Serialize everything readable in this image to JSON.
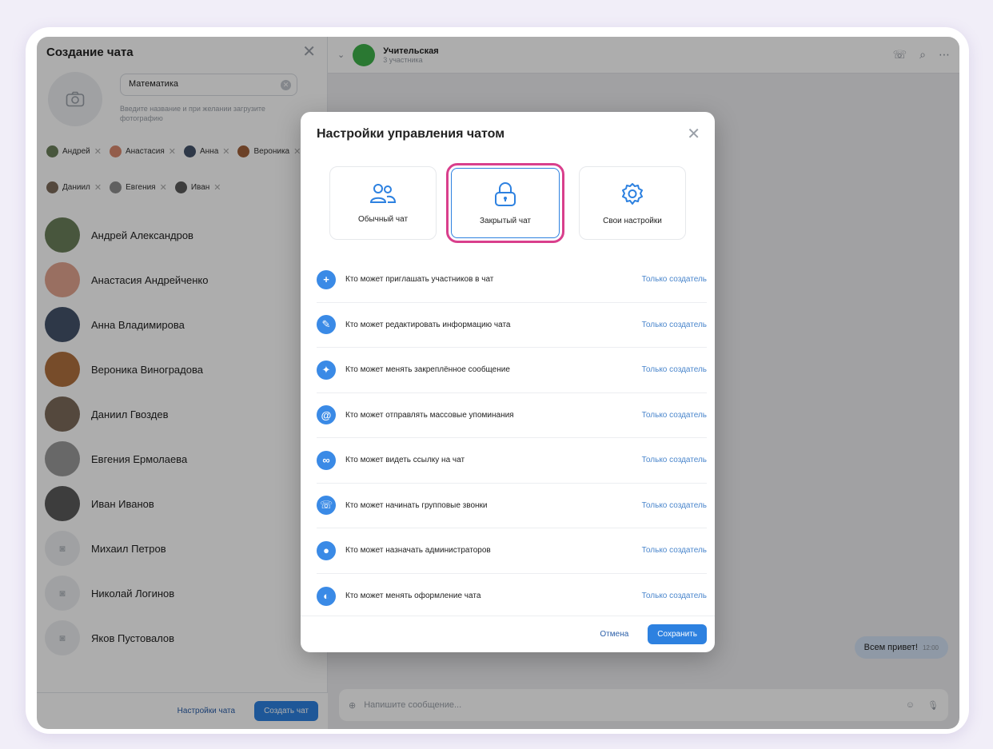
{
  "left_panel": {
    "title": "Создание чата",
    "name_value": "Математика",
    "name_hint": "Введите название и при желании загрузите фотографию",
    "chips": [
      {
        "name": "Андрей",
        "color": "#6b7f5a"
      },
      {
        "name": "Анастасия",
        "color": "#d98a6f"
      },
      {
        "name": "Анна",
        "color": "#44536b"
      },
      {
        "name": "Вероника",
        "color": "#a0603a"
      },
      {
        "name": "Даниил",
        "color": "#7d6a5a"
      },
      {
        "name": "Евгения",
        "color": "#8e8e8e"
      },
      {
        "name": "Иван",
        "color": "#5b5b5b"
      }
    ],
    "contacts": [
      {
        "name": "Андрей Александров",
        "color": "#6b7f5a"
      },
      {
        "name": "Анастасия Андрейченко",
        "color": "#e2a48f"
      },
      {
        "name": "Анна Владимирова",
        "color": "#44536b"
      },
      {
        "name": "Вероника Виноградова",
        "color": "#b0703f"
      },
      {
        "name": "Даниил Гвоздев",
        "color": "#7d6a5a"
      },
      {
        "name": "Евгения Ермолаева",
        "color": "#9a9a9a"
      },
      {
        "name": "Иван Иванов",
        "color": "#5b5b5b"
      },
      {
        "name": "Михаил Петров",
        "color": "#eceef1"
      },
      {
        "name": "Николай Логинов",
        "color": "#eceef1"
      },
      {
        "name": "Яков Пустовалов",
        "color": "#eceef1"
      }
    ],
    "settings_label": "Настройки чата",
    "create_label": "Создать чат"
  },
  "chat": {
    "title": "Учительская",
    "subtitle": "3 участника",
    "message": "Всем привет!",
    "message_time": "12:00",
    "composer_placeholder": "Напишите сообщение..."
  },
  "modal": {
    "title": "Настройки управления чатом",
    "modes": [
      {
        "label": "Обычный чат",
        "icon": "users-icon"
      },
      {
        "label": "Закрытый чат",
        "icon": "lock-icon"
      },
      {
        "label": "Свои настройки",
        "icon": "gear-icon"
      }
    ],
    "rows": [
      {
        "label": "Кто может приглашать участников в чат",
        "value": "Только создатель",
        "icon": "plus-icon"
      },
      {
        "label": "Кто может редактировать информацию чата",
        "value": "Только создатель",
        "icon": "pencil-icon"
      },
      {
        "label": "Кто может менять закреплённое сообщение",
        "value": "Только создатель",
        "icon": "pin-icon"
      },
      {
        "label": "Кто может отправлять массовые упоминания",
        "value": "Только создатель",
        "icon": "at-icon"
      },
      {
        "label": "Кто может видеть ссылку на чат",
        "value": "Только создатель",
        "icon": "link-icon"
      },
      {
        "label": "Кто может начинать групповые звонки",
        "value": "Только создатель",
        "icon": "phone-icon"
      },
      {
        "label": "Кто может назначать администраторов",
        "value": "Только создатель",
        "icon": "user-icon"
      },
      {
        "label": "Кто может менять оформление чата",
        "value": "Только создатель",
        "icon": "palette-icon"
      }
    ],
    "cancel_label": "Отмена",
    "save_label": "Сохранить"
  },
  "colors": {
    "accent": "#2d81e0",
    "highlight": "#d93f8c",
    "row_icon": "#3a8ae6",
    "value_link": "#4a86cc"
  }
}
